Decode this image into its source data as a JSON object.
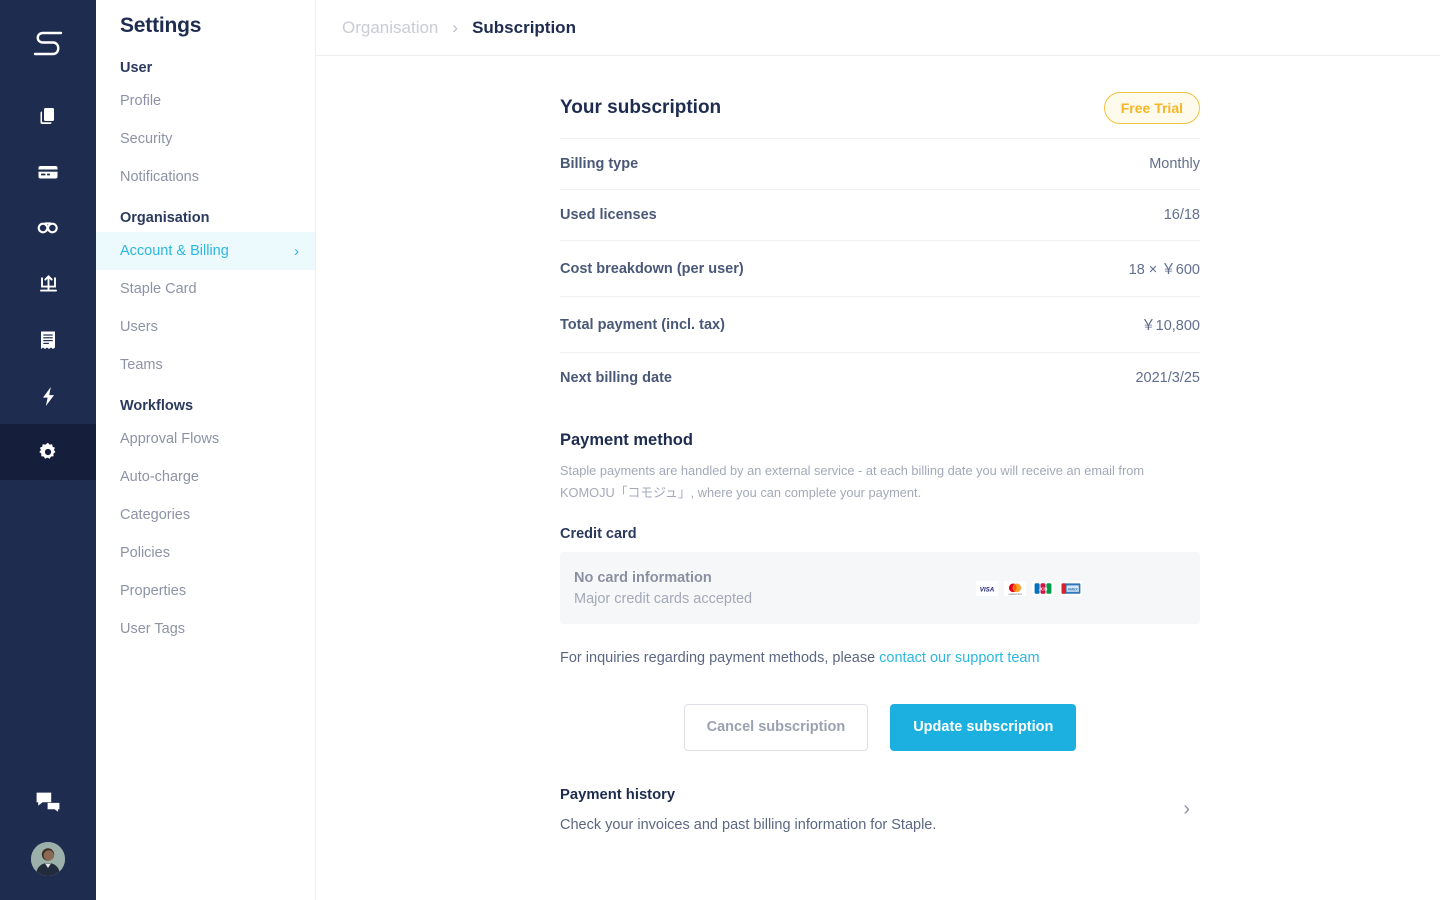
{
  "brand": {
    "logo_icon": "staple-s-logo"
  },
  "rail": {
    "items": [
      {
        "icon": "documents-icon",
        "name": "documents"
      },
      {
        "icon": "credit-card-icon",
        "name": "cards"
      },
      {
        "icon": "infinity-icon",
        "name": "integrations"
      },
      {
        "icon": "upload-icon",
        "name": "upload"
      },
      {
        "icon": "receipt-icon",
        "name": "receipts"
      },
      {
        "icon": "lightning-bolt-icon",
        "name": "automation"
      },
      {
        "icon": "gear-icon",
        "name": "settings",
        "active": true
      }
    ],
    "chat_icon": "chat-bubbles-icon",
    "avatar_icon": "user-avatar"
  },
  "settings": {
    "title": "Settings",
    "groups": [
      {
        "label": "User",
        "items": [
          {
            "label": "Profile",
            "active": false
          },
          {
            "label": "Security",
            "active": false
          },
          {
            "label": "Notifications",
            "active": false
          }
        ]
      },
      {
        "label": "Organisation",
        "items": [
          {
            "label": "Account & Billing",
            "active": true,
            "chevron": "›"
          },
          {
            "label": "Staple Card",
            "active": false
          },
          {
            "label": "Users",
            "active": false
          },
          {
            "label": "Teams",
            "active": false
          }
        ]
      },
      {
        "label": "Workflows",
        "items": [
          {
            "label": "Approval Flows",
            "active": false
          },
          {
            "label": "Auto-charge",
            "active": false
          },
          {
            "label": "Categories",
            "active": false
          },
          {
            "label": "Policies",
            "active": false
          },
          {
            "label": "Properties",
            "active": false
          },
          {
            "label": "User Tags",
            "active": false
          }
        ]
      }
    ]
  },
  "breadcrumb": {
    "previous": "Organisation",
    "separator": "›",
    "current": "Subscription"
  },
  "subscription": {
    "title": "Your subscription",
    "badge": "Free Trial",
    "rows": [
      {
        "key": "Billing type",
        "value": "Monthly"
      },
      {
        "key": "Used licenses",
        "value": "16/18"
      },
      {
        "key": "Cost breakdown (per user)",
        "value": "18 × ￥600"
      },
      {
        "key": "Total payment (incl. tax)",
        "value": "￥10,800"
      },
      {
        "key": "Next billing date",
        "value": "2021/3/25"
      }
    ]
  },
  "payment_method": {
    "title": "Payment method",
    "description": "Staple payments are handled by an external service - at each billing date you will receive an email from KOMOJU「コモジュ」, where you can complete your payment.",
    "credit_card_label": "Credit card",
    "card_none": "No card information",
    "card_accepted": "Major credit cards accepted",
    "card_logos": [
      "visa-logo",
      "mastercard-logo",
      "jcb-logo",
      "amex-logo"
    ],
    "inquiry_prefix": "For inquiries regarding payment methods, please ",
    "inquiry_link": "contact our support team"
  },
  "actions": {
    "cancel": "Cancel subscription",
    "update": "Update subscription"
  },
  "payment_history": {
    "title": "Payment history",
    "description": "Check your invoices and past billing information for Staple.",
    "chevron": "›"
  },
  "colors": {
    "rail_bg": "#1e2c4f",
    "rail_active": "#151f3b",
    "accent": "#2bb7e0",
    "primary_button": "#1cb0e0",
    "badge_border": "#f5c342",
    "badge_text": "#f5b625",
    "badge_bg": "#fefaec",
    "heading": "#1e2c4f"
  }
}
